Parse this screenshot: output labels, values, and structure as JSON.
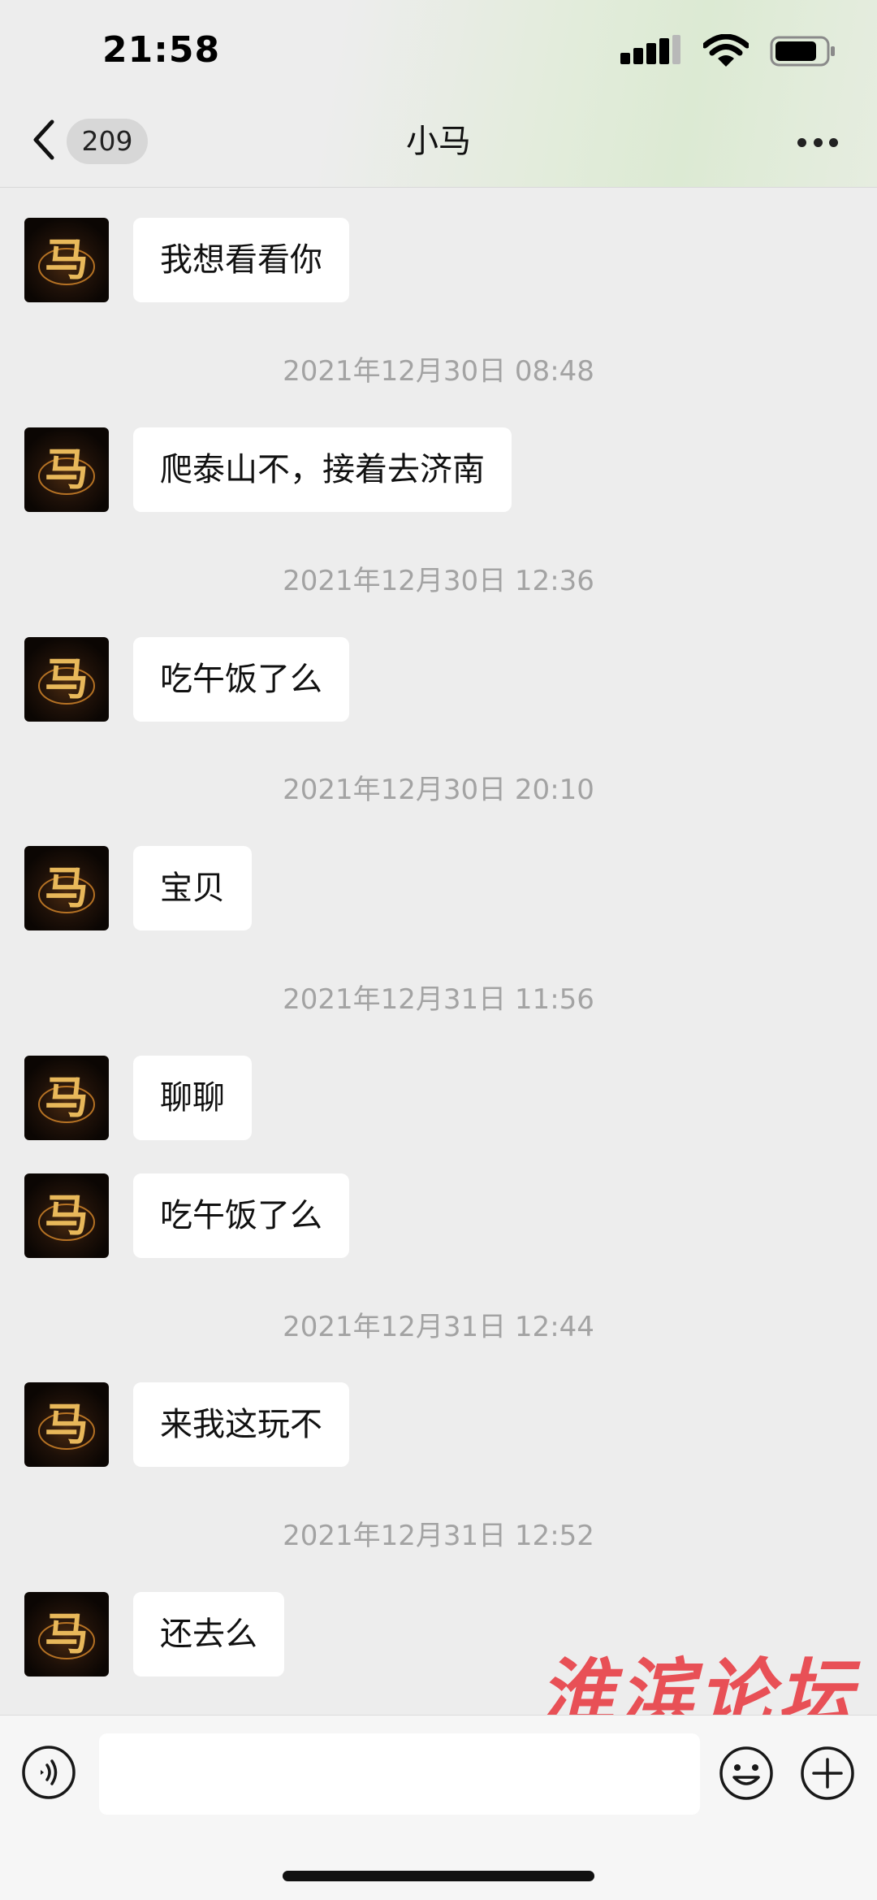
{
  "status_bar": {
    "time": "21:58"
  },
  "nav": {
    "badge_count": "209",
    "title": "小马"
  },
  "messages": [
    {
      "type": "msg",
      "text": "我想看看你"
    },
    {
      "type": "time",
      "text": "2021年12月30日 08:48"
    },
    {
      "type": "msg",
      "text": "爬泰山不，接着去济南"
    },
    {
      "type": "time",
      "text": "2021年12月30日 12:36"
    },
    {
      "type": "msg",
      "text": "吃午饭了么"
    },
    {
      "type": "time",
      "text": "2021年12月30日 20:10"
    },
    {
      "type": "msg",
      "text": "宝贝"
    },
    {
      "type": "time",
      "text": "2021年12月31日 11:56"
    },
    {
      "type": "msg",
      "text": "聊聊"
    },
    {
      "type": "msg",
      "text": "吃午饭了么"
    },
    {
      "type": "time",
      "text": "2021年12月31日 12:44"
    },
    {
      "type": "msg",
      "text": "来我这玩不"
    },
    {
      "type": "time",
      "text": "2021年12月31日 12:52"
    },
    {
      "type": "msg",
      "text": "还去么"
    }
  ],
  "watermark": "淮滨论坛",
  "input": {
    "placeholder": ""
  },
  "icons": {
    "back": "chevron-left-icon",
    "more": "more-dots-icon",
    "voice": "voice-icon",
    "emoji": "emoji-icon",
    "plus": "plus-icon"
  },
  "colors": {
    "watermark": "#e8434a",
    "background": "#ededed",
    "bubble": "#ffffff"
  }
}
